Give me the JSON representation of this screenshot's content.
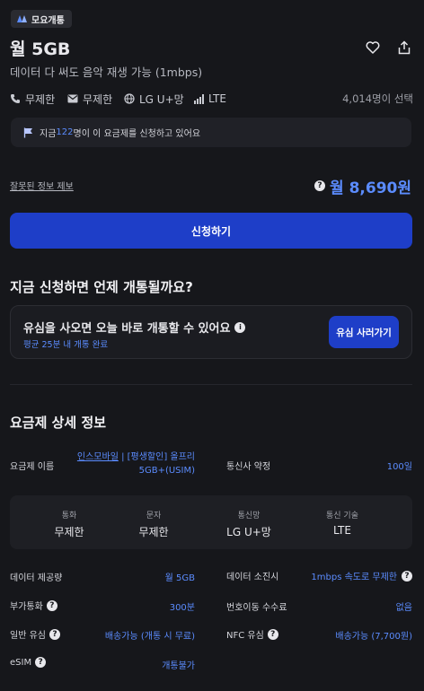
{
  "brand": {
    "name": "모요개통"
  },
  "plan": {
    "title": "월 5GB",
    "subtitle": "데이터 다 써도 음악 재생 가능 (1mbps)",
    "features": [
      "무제한",
      "무제한",
      "LG U+망",
      "LTE"
    ],
    "selected_count": "4,014명이 선택"
  },
  "notice": {
    "prefix": "지금 ",
    "count": "122",
    "suffix": "명이 이 요금제를 신청하고 있어요"
  },
  "report_link": "잘못된 정보 제보",
  "price": "월 8,690원",
  "apply_button": "신청하기",
  "activation": {
    "heading": "지금 신청하면 언제 개통될까요?",
    "card_title": "유심을 사오면 오늘 바로 개통할 수 있어요",
    "card_sub": "평균 25분 내 개통 완료",
    "card_button": "유심 사러가기"
  },
  "details": {
    "heading": "요금제 상세 정보",
    "plan_name_label": "요금제 이름",
    "plan_name_link": "인스모바일",
    "plan_name_rest": " | [평생할인] 올프리",
    "plan_name_line2": "5GB+(USIM)",
    "contract_label": "통신사 약정",
    "contract_value": "100일",
    "grid": [
      {
        "label": "통화",
        "value": "무제한"
      },
      {
        "label": "문자",
        "value": "무제한"
      },
      {
        "label": "통신망",
        "value": "LG U+망"
      },
      {
        "label": "통신 기술",
        "value": "LTE"
      }
    ],
    "rows": [
      {
        "left_label": "데이터 제공량",
        "left_value": "월 5GB",
        "right_label": "데이터 소진시",
        "right_value": "1mbps 속도로 무제한"
      },
      {
        "left_label": "부가통화",
        "left_value": "300분",
        "right_label": "번호이동 수수료",
        "right_value": "없음"
      },
      {
        "left_label": "일반 유심",
        "left_value": "배송가능 (개통 시 무료)",
        "right_label": "NFC 유심",
        "right_value": "배송가능 (7,700원)"
      },
      {
        "left_label": "eSIM",
        "left_value": "개통불가"
      }
    ]
  }
}
